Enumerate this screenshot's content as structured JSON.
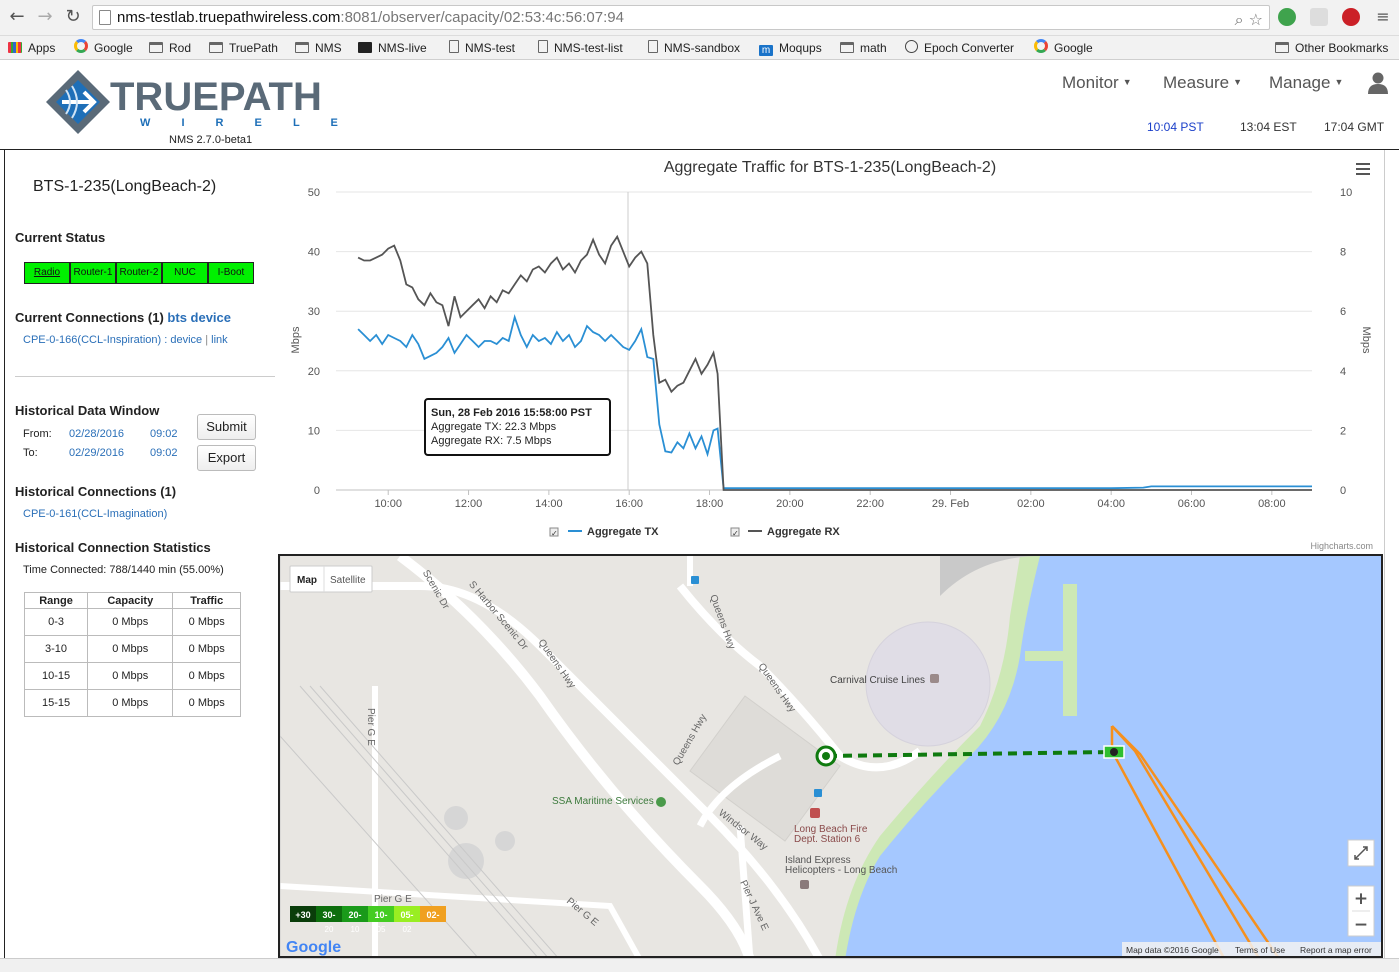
{
  "browser": {
    "url_host": "nms-testlab.truepathwireless.com",
    "url_rest": ":8081/observer/capacity/02:53:4c:56:07:94",
    "bookmarks": [
      "Apps",
      "Google",
      "Rod",
      "TruePath",
      "NMS",
      "NMS-live",
      "NMS-test",
      "NMS-test-list",
      "NMS-sandbox",
      "Moqups",
      "math",
      "Epoch Converter",
      "Google"
    ],
    "other_bookmarks": "Other Bookmarks"
  },
  "header": {
    "logo_main": "TRUEPATH",
    "logo_sub": "W I R E L E S S",
    "version": "NMS 2.7.0-beta1",
    "menu": [
      "Monitor",
      "Measure",
      "Manage"
    ],
    "times": [
      "10:04 PST",
      "13:04 EST",
      "17:04 GMT"
    ],
    "colors": {
      "local_time": "#1a3fc9",
      "brand_blue": "#1e6fb8",
      "brand_grey": "#5a6a78"
    }
  },
  "left": {
    "bts_name": "BTS-1-235(LongBeach-2)",
    "current_status_title": "Current Status",
    "status_cells": [
      "Radio",
      "Router-1",
      "Router-2",
      "NUC",
      "I-Boot"
    ],
    "status_color": "#00f000",
    "current_connections_title": "Current Connections (1)",
    "bts_device_link": "bts device",
    "current_conn_name": "CPE-0-166(CCL-Inspiration)",
    "current_conn_sep1": " : ",
    "device_link": "device",
    "current_conn_sep2": " | ",
    "link_link": "link",
    "history_window_title": "Historical Data Window",
    "from_label": "From:",
    "from_date": "02/28/2016",
    "from_time": "09:02",
    "to_label": "To:",
    "to_date": "02/29/2016",
    "to_time": "09:02",
    "submit": "Submit",
    "export": "Export",
    "historical_connections_title": "Historical Connections (1)",
    "historical_conn": "CPE-0-161(CCL-Imagination)",
    "stats_title": "Historical Connection Statistics",
    "time_connected": "Time Connected: 788/1440 min (55.00%)",
    "table_headers": [
      "Range",
      "Capacity",
      "Traffic"
    ],
    "table_rows": [
      [
        "0-3",
        "0 Mbps",
        "0 Mbps"
      ],
      [
        "3-10",
        "0 Mbps",
        "0 Mbps"
      ],
      [
        "10-15",
        "0 Mbps",
        "0 Mbps"
      ],
      [
        "15-15",
        "0 Mbps",
        "0 Mbps"
      ]
    ]
  },
  "chart_data": {
    "type": "line",
    "title": "Aggregate Traffic for BTS-1-235(LongBeach-2)",
    "ylabel": "Mbps",
    "ylabel_right": "Mbps",
    "ylim": [
      0,
      50
    ],
    "ylim_right": [
      0,
      10
    ],
    "yticks": [
      0,
      10,
      20,
      30,
      40,
      50
    ],
    "yticks_right": [
      0,
      2,
      4,
      6,
      8,
      10
    ],
    "xlim_hours": [
      8.7,
      33.0
    ],
    "xtick_labels": [
      "10:00",
      "12:00",
      "14:00",
      "16:00",
      "18:00",
      "20:00",
      "22:00",
      "29. Feb",
      "02:00",
      "04:00",
      "06:00",
      "08:00"
    ],
    "xtick_hours": [
      10,
      12,
      14,
      16,
      18,
      20,
      22,
      24,
      26,
      28,
      30,
      32
    ],
    "grid": "horizontal",
    "legend": "bottom-center",
    "credit": "Highcharts.com",
    "crosshair_hour": 15.97,
    "tooltip": {
      "header": "Sun, 28 Feb 2016 15:58:00 PST",
      "line1": "Aggregate TX: 22.3 Mbps",
      "line2": "Aggregate RX: 7.5 Mbps"
    },
    "series": [
      {
        "name": "Aggregate TX",
        "color": "#2a8fd4",
        "axis": "left",
        "x": [
          9.25,
          9.4,
          9.55,
          9.7,
          9.85,
          10.0,
          10.15,
          10.3,
          10.45,
          10.6,
          10.75,
          10.9,
          11.05,
          11.2,
          11.35,
          11.5,
          11.65,
          11.8,
          11.95,
          12.1,
          12.25,
          12.4,
          12.55,
          12.7,
          12.85,
          13.0,
          13.15,
          13.3,
          13.45,
          13.6,
          13.75,
          13.9,
          14.05,
          14.2,
          14.35,
          14.5,
          14.65,
          14.8,
          14.95,
          15.1,
          15.25,
          15.4,
          15.55,
          15.7,
          15.85,
          16.0,
          16.15,
          16.3,
          16.45,
          16.6,
          16.75,
          16.9,
          17.05,
          17.2,
          17.35,
          17.5,
          17.65,
          17.8,
          17.95,
          18.1,
          18.2,
          18.35,
          20.0,
          22.0,
          24.0,
          26.0,
          28.0,
          28.8,
          29.0,
          31.0,
          33.0
        ],
        "y": [
          27,
          26,
          25,
          26,
          24.5,
          26,
          25.5,
          25,
          24,
          26,
          24.5,
          22,
          22.5,
          23,
          24,
          25.5,
          23,
          24.5,
          26,
          25,
          24,
          25,
          25,
          24.5,
          25.5,
          25,
          29,
          26,
          24,
          26,
          25,
          25.5,
          24.5,
          26.5,
          25,
          26,
          24,
          25,
          27.5,
          26.5,
          26,
          25,
          26,
          25,
          24,
          23.5,
          25,
          27,
          22.3,
          22,
          11,
          6.5,
          6.3,
          8,
          7,
          9.5,
          7,
          9,
          6,
          10,
          10.3,
          0.3,
          0.3,
          0.3,
          0.3,
          0.3,
          0.3,
          0.4,
          0.6,
          0.6,
          0.6
        ]
      },
      {
        "name": "Aggregate RX",
        "color": "#555555",
        "axis": "right",
        "x": [
          9.25,
          9.4,
          9.55,
          9.7,
          9.85,
          10.0,
          10.15,
          10.3,
          10.45,
          10.6,
          10.75,
          10.9,
          11.05,
          11.2,
          11.35,
          11.5,
          11.65,
          11.8,
          11.95,
          12.1,
          12.25,
          12.4,
          12.55,
          12.7,
          12.85,
          13.0,
          13.15,
          13.3,
          13.45,
          13.6,
          13.75,
          13.9,
          14.05,
          14.2,
          14.35,
          14.5,
          14.65,
          14.8,
          14.95,
          15.1,
          15.25,
          15.4,
          15.55,
          15.7,
          15.85,
          16.0,
          16.15,
          16.3,
          16.45,
          16.6,
          16.75,
          16.9,
          17.05,
          17.2,
          17.35,
          17.5,
          17.65,
          17.8,
          17.95,
          18.1,
          18.2,
          18.35,
          20.0,
          22.0,
          24.0,
          26.0,
          28.0,
          33.0
        ],
        "y": [
          7.8,
          7.7,
          7.7,
          7.8,
          7.9,
          8.1,
          8.2,
          7.7,
          6.9,
          6.8,
          6.4,
          6.2,
          6.6,
          6.3,
          6.2,
          5.5,
          6.5,
          5.8,
          6.0,
          6.2,
          6.4,
          6.1,
          6.5,
          6.3,
          6.7,
          6.6,
          6.9,
          7.2,
          7.0,
          7.4,
          7.5,
          7.3,
          7.6,
          7.8,
          7.4,
          7.6,
          7.3,
          7.7,
          7.9,
          8.4,
          7.9,
          7.6,
          8.2,
          8.5,
          8.0,
          7.5,
          7.8,
          8.0,
          7.6,
          5.2,
          3.6,
          3.7,
          3.3,
          3.5,
          3.6,
          4.0,
          4.4,
          3.9,
          4.2,
          4.6,
          3.9,
          0.0,
          0.0,
          0.0,
          0.0,
          0.0,
          0.0,
          0.0
        ]
      }
    ]
  },
  "map": {
    "tabs": [
      "Map",
      "Satellite"
    ],
    "labels": {
      "carnival": "Carnival Cruise Lines",
      "ssa": "SSA Maritime Services",
      "fire1": "Long Beach Fire",
      "fire2": "Dept. Station 6",
      "island1": "Island Express",
      "island2": "Helicopters - Long Beach",
      "harbor": "S Harbor Scenic Dr",
      "queens1": "Queens Hwy",
      "queens2": "Queens Hwy",
      "queens3": "Queens Hwy",
      "queens4": "Queens Hwy",
      "windsor": "Windsor Way",
      "pierj": "Pier J Ave E",
      "pierg1": "Pier G E",
      "pierg2": "Pier G E",
      "pierg3": "Pier G E",
      "scenic": "Scenic Dr"
    },
    "legend_top": [
      "+30",
      "30-",
      "20-",
      "10-",
      "05-",
      "02-"
    ],
    "legend_bottom": [
      "20",
      "10",
      "05",
      "02"
    ],
    "legend_colors": [
      "#0a3d0a",
      "#0d6e0d",
      "#1a9a1a",
      "#44cc22",
      "#99ee22",
      "#f0a020"
    ],
    "google": "Google",
    "footer": [
      "Map data ©2016 Google",
      "Terms of Use",
      "Report a map error"
    ],
    "zoom_in": "+",
    "zoom_out": "−",
    "colors": {
      "water": "#a5c8ff",
      "land": "#e8e6e2",
      "park": "#cde8b5",
      "link_green": "#0f7a0f",
      "link_orange": "#f5901e"
    }
  }
}
